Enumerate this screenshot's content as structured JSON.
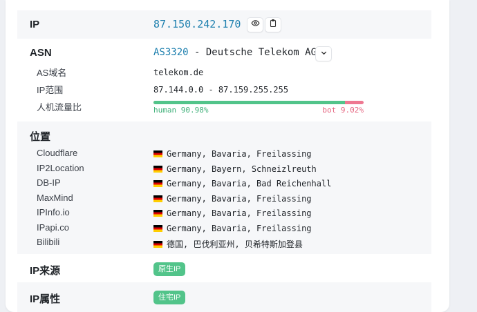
{
  "ip": {
    "label": "IP",
    "address": "87.150.242.170",
    "icons": [
      "eye-icon",
      "clipboard-icon"
    ]
  },
  "asn": {
    "label": "ASN",
    "number": "AS3320",
    "name": " - Deutsche Telekom AG",
    "domain_label": "AS域名",
    "domain": "telekom.de",
    "range_label": "IP范围",
    "range": "87.144.0.0 - 87.159.255.255",
    "traffic_label": "人机流量比",
    "human_text": "human 90.98%",
    "bot_text": "bot 9.02%",
    "human_fraction": 0.9098,
    "colors": {
      "accent": "#1d7fae",
      "human": "#52c48a",
      "bot": "#ee7891"
    }
  },
  "location": {
    "label": "位置",
    "sources": [
      {
        "name": "Cloudflare",
        "value": "Germany, Bavaria, Freilassing"
      },
      {
        "name": "IP2Location",
        "value": "Germany, Bayern, Schneizlreuth"
      },
      {
        "name": "DB-IP",
        "value": "Germany, Bavaria, Bad Reichenhall"
      },
      {
        "name": "MaxMind",
        "value": "Germany, Bavaria, Freilassing"
      },
      {
        "name": "IPInfo.io",
        "value": "Germany, Bavaria, Freilassing"
      },
      {
        "name": "IPapi.co",
        "value": "Germany, Bavaria, Freilassing"
      },
      {
        "name": "Bilibili",
        "value": "德国, 巴伐利亚州, 贝希特斯加登县"
      }
    ]
  },
  "source": {
    "label": "IP来源",
    "badge": "原生IP"
  },
  "attribute": {
    "label": "IP属性",
    "badge": "住宅IP"
  }
}
